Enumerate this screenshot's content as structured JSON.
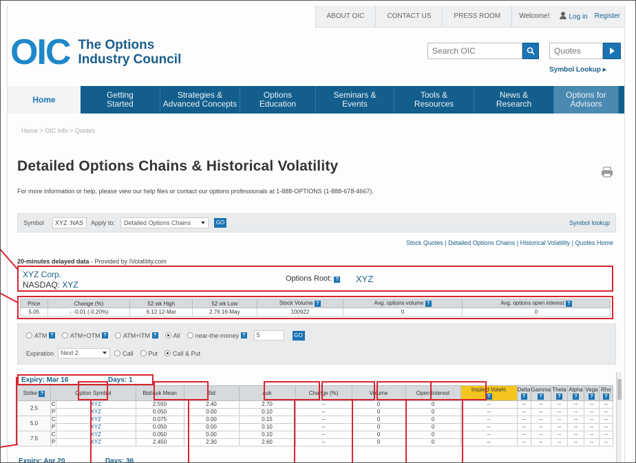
{
  "topnav": {
    "about": "ABOUT OIC",
    "contact": "CONTACT US",
    "press": "PRESS ROOM",
    "welcome": "Welcome!",
    "login": "Log in",
    "register": "Register"
  },
  "logo": {
    "mark": "OIC",
    "line1": "The Options",
    "line2": "Industry Council"
  },
  "search": {
    "placeholder": "Search OIC",
    "quotes_placeholder": "Quotes",
    "symbol_lookup": "Symbol Lookup ▸"
  },
  "mainnav": [
    "Home",
    "Getting\nStarted",
    "Strategies &\nAdvanced Concepts",
    "Options\nEducation",
    "Seminars &\nEvents",
    "Tools &\nResources",
    "News &\nResearch",
    "Options for\nAdvisors"
  ],
  "breadcrumb": "Home > OIC Info > Quotes",
  "page": {
    "title": "Detailed Options Chains & Historical Volatility",
    "intro": "For more information or help, please view our help files or contact our options professionals at 1-888-OPTIONS (1-888-678-4667)."
  },
  "symbar": {
    "symbol_label": "Symbol",
    "symbol_value": "XYZ :NAS",
    "apply_label": "Apply to:",
    "apply_value": "Detailed Options Chains",
    "go": "GO",
    "lookup": "Symbol lookup"
  },
  "links_row": "Stock Quotes | Detailed Options Chains | Historical Volatility | Quotes Home",
  "delayed": {
    "bold": "20-minutes delayed data",
    "rest": " - Provided by IVolatility.com"
  },
  "company": {
    "name": "XYZ Corp.",
    "exchange": "NASDAQ:",
    "ticker": "XYZ",
    "options_root_label": "Options Root:",
    "options_root_value": "XYZ"
  },
  "quote": {
    "headers": [
      "Price",
      "Change (%)",
      "52 wk High",
      "52 wk Low",
      "Stock Volume",
      "Avg. options volume",
      "Avg. options open interest"
    ],
    "values": [
      "5.05",
      "-0.01 (-0.20%)",
      "6.12 12-Mar",
      "2.76 16-May",
      "100922",
      "0",
      "0"
    ]
  },
  "filters": {
    "atm": "ATM",
    "atm_otm": "ATM+OTM",
    "atm_itm": "ATM+ITM",
    "all": "All",
    "near": "near-the-money",
    "near_value": "5",
    "go": "GO",
    "expiration_label": "Expiration",
    "expiration_value": "Next 2",
    "call": "Call",
    "put": "Put",
    "call_put": "Call & Put"
  },
  "chain": {
    "expiry": "Expiry: Mar 16",
    "days": "Days: 1",
    "headers": [
      "Strike",
      "Option Symbol",
      "Bid/Ask Mean",
      "Bid",
      "Ask",
      "Change (%)",
      "Volume",
      "Open Interest",
      "Implied Vola%",
      "Delta",
      "Gamma",
      "Theta",
      "Alpha",
      "Vega",
      "Rho"
    ],
    "rows": [
      {
        "strike": "2.5",
        "cp": "C",
        "sym": "XYZ",
        "mean": "2.550",
        "bid": "2.40",
        "ask": "2.70",
        "chg": "--",
        "vol": "0",
        "oi": "0",
        "iv": "--",
        "g": "--"
      },
      {
        "strike": "",
        "cp": "P",
        "sym": "XYZ",
        "mean": "0.050",
        "bid": "0.00",
        "ask": "0.10",
        "chg": "--",
        "vol": "0",
        "oi": "0",
        "iv": "--",
        "g": "--"
      },
      {
        "strike": "5.0",
        "cp": "C",
        "sym": "XYZ",
        "mean": "0.075",
        "bid": "0.00",
        "ask": "0.15",
        "chg": "--",
        "vol": "0",
        "oi": "0",
        "iv": "--",
        "g": "--"
      },
      {
        "strike": "",
        "cp": "P",
        "sym": "XYZ",
        "mean": "0.050",
        "bid": "0.00",
        "ask": "0.10",
        "chg": "--",
        "vol": "0",
        "oi": "0",
        "iv": "--",
        "g": "--"
      },
      {
        "strike": "7.5",
        "cp": "C",
        "sym": "XYZ",
        "mean": "0.050",
        "bid": "0.00",
        "ask": "0.10",
        "chg": "--",
        "vol": "0",
        "oi": "0",
        "iv": "--",
        "g": "--"
      },
      {
        "strike": "",
        "cp": "P",
        "sym": "XYZ",
        "mean": "2.450",
        "bid": "2.30",
        "ask": "2.60",
        "chg": "--",
        "vol": "0",
        "oi": "0",
        "iv": "--",
        "g": "--"
      }
    ],
    "expiry2": "Expiry: Apr 20",
    "days2": "Days: 36"
  },
  "colors": {
    "brand": "#1e88c8",
    "nav": "#135e8c",
    "highlight": "#d9232e",
    "iv_header": "#f4c51e"
  }
}
